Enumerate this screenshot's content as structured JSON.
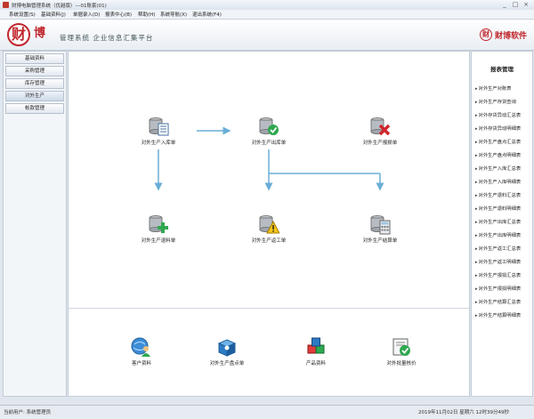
{
  "window": {
    "title": "财博电脑管理系统（优越版）---01账套(01)",
    "controls": [
      "_",
      "□",
      "×"
    ]
  },
  "menu": [
    "系统设置(S)",
    "基础资料(J)",
    "单据录入(D)",
    "报表中心(B)",
    "帮助(H)",
    "系统导航(X)",
    "退出系统(F4)"
  ],
  "banner": {
    "logo_char": "财",
    "brand": "博",
    "slogan": "管理系统  企业信息汇集平台",
    "right_logo_char": "财",
    "right_brand": "财博软件"
  },
  "left_nav": [
    "基础资料",
    "采购管理",
    "库存管理",
    "对外生产",
    "帐款管理"
  ],
  "flow_nodes": [
    {
      "label": "对外生产入库单",
      "icon": "doc-database-icon"
    },
    {
      "label": "对外生产出库单",
      "icon": "check-database-icon"
    },
    {
      "label": "对外生产报损单",
      "icon": "delete-database-icon"
    },
    {
      "label": "对外生产退料单",
      "icon": "add-database-icon"
    },
    {
      "label": "对外生产返工单",
      "icon": "warning-database-icon"
    },
    {
      "label": "对外生产结算单",
      "icon": "calculator-database-icon"
    }
  ],
  "bottom_nodes": [
    {
      "label": "客户资料",
      "icon": "customer-globe-icon"
    },
    {
      "label": "对外生产盘点单",
      "icon": "inventory-box-icon"
    },
    {
      "label": "产品资料",
      "icon": "product-cubes-icon"
    },
    {
      "label": "对外批量核价",
      "icon": "price-check-icon"
    }
  ],
  "report_panel": {
    "title": "报表管理",
    "items": [
      "对外生产对账表",
      "对外生产存货查询",
      "对外存货异动汇总表",
      "对外存货异动明细表",
      "对外生产盘点汇总表",
      "对外生产盘点明细表",
      "对外生产入库汇总表",
      "对外生产入库明细表",
      "对外生产退料汇总表",
      "对外生产退料明细表",
      "对外生产出库汇总表",
      "对外生产出库明细表",
      "对外生产返工汇总表",
      "对外生产返工明细表",
      "对外生产报损汇总表",
      "对外生产报损明细表",
      "对外生产结算汇总表",
      "对外生产结算明细表"
    ]
  },
  "status": {
    "user": "当前用户: 系统管理员",
    "datetime": "2019年11月02日  星期六  12时39分49秒"
  },
  "colors": {
    "arrow": "#6aaed6",
    "brand_red": "#c0262d"
  }
}
